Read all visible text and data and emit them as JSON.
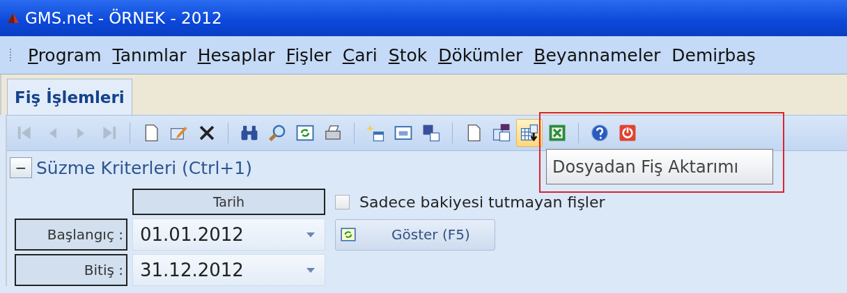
{
  "window": {
    "title": "GMS.net - ÖRNEK - 2012"
  },
  "menu": [
    {
      "key": "P",
      "after": "rogram"
    },
    {
      "key": "T",
      "after": "anımlar"
    },
    {
      "key": "H",
      "after": "esaplar"
    },
    {
      "key": "F",
      "after": "işler"
    },
    {
      "key": "C",
      "after": "ari"
    },
    {
      "key": "S",
      "after": "tok"
    },
    {
      "key": "D",
      "after": "ökümler"
    },
    {
      "key": "B",
      "after": "eyannameler"
    },
    {
      "before": "Demi",
      "key": "r",
      "after": "baş"
    }
  ],
  "tabs": [
    {
      "label": "Fiş İşlemleri",
      "selected": true
    }
  ],
  "toolbar": [
    {
      "kind": "first",
      "disabled": true,
      "hovered": false
    },
    {
      "kind": "prev",
      "disabled": true,
      "hovered": false
    },
    {
      "kind": "next",
      "disabled": true,
      "hovered": false
    },
    {
      "kind": "last",
      "disabled": true,
      "hovered": false
    },
    {
      "kind": "separator"
    },
    {
      "kind": "new",
      "disabled": false,
      "hovered": false
    },
    {
      "kind": "edit",
      "disabled": false,
      "hovered": false
    },
    {
      "kind": "delete",
      "disabled": false,
      "hovered": false
    },
    {
      "kind": "separator"
    },
    {
      "kind": "find",
      "disabled": false,
      "hovered": false
    },
    {
      "kind": "search",
      "disabled": false,
      "hovered": false
    },
    {
      "kind": "refresh",
      "disabled": false,
      "hovered": false
    },
    {
      "kind": "print",
      "disabled": false,
      "hovered": false
    },
    {
      "kind": "separator"
    },
    {
      "kind": "add",
      "disabled": false,
      "hovered": false
    },
    {
      "kind": "window",
      "disabled": false,
      "hovered": false
    },
    {
      "kind": "save",
      "disabled": false,
      "hovered": false
    },
    {
      "kind": "separator"
    },
    {
      "kind": "page",
      "disabled": false,
      "hovered": false
    },
    {
      "kind": "copy",
      "disabled": false,
      "hovered": false
    },
    {
      "kind": "import",
      "disabled": false,
      "hovered": true
    },
    {
      "kind": "excel",
      "disabled": false,
      "hovered": false
    },
    {
      "kind": "separator"
    },
    {
      "kind": "help",
      "disabled": false,
      "hovered": false
    },
    {
      "kind": "power",
      "disabled": false,
      "hovered": false
    }
  ],
  "tooltip": {
    "text": "Dosyadan Fiş Aktarımı",
    "highlighted": true
  },
  "filter": {
    "title": "Süzme Kriterleri (Ctrl+1)",
    "expanded": true,
    "toggle": "−",
    "date_header": "Tarih",
    "rows": [
      {
        "label": "Başlangıç :",
        "value": "01.01.2012"
      },
      {
        "label": "Bitiş :",
        "value": "31.12.2012"
      }
    ],
    "checkbox": {
      "label": "Sadece bakiyesi tutmayan fişler",
      "checked": false
    },
    "button": "Göster (F5)"
  }
}
